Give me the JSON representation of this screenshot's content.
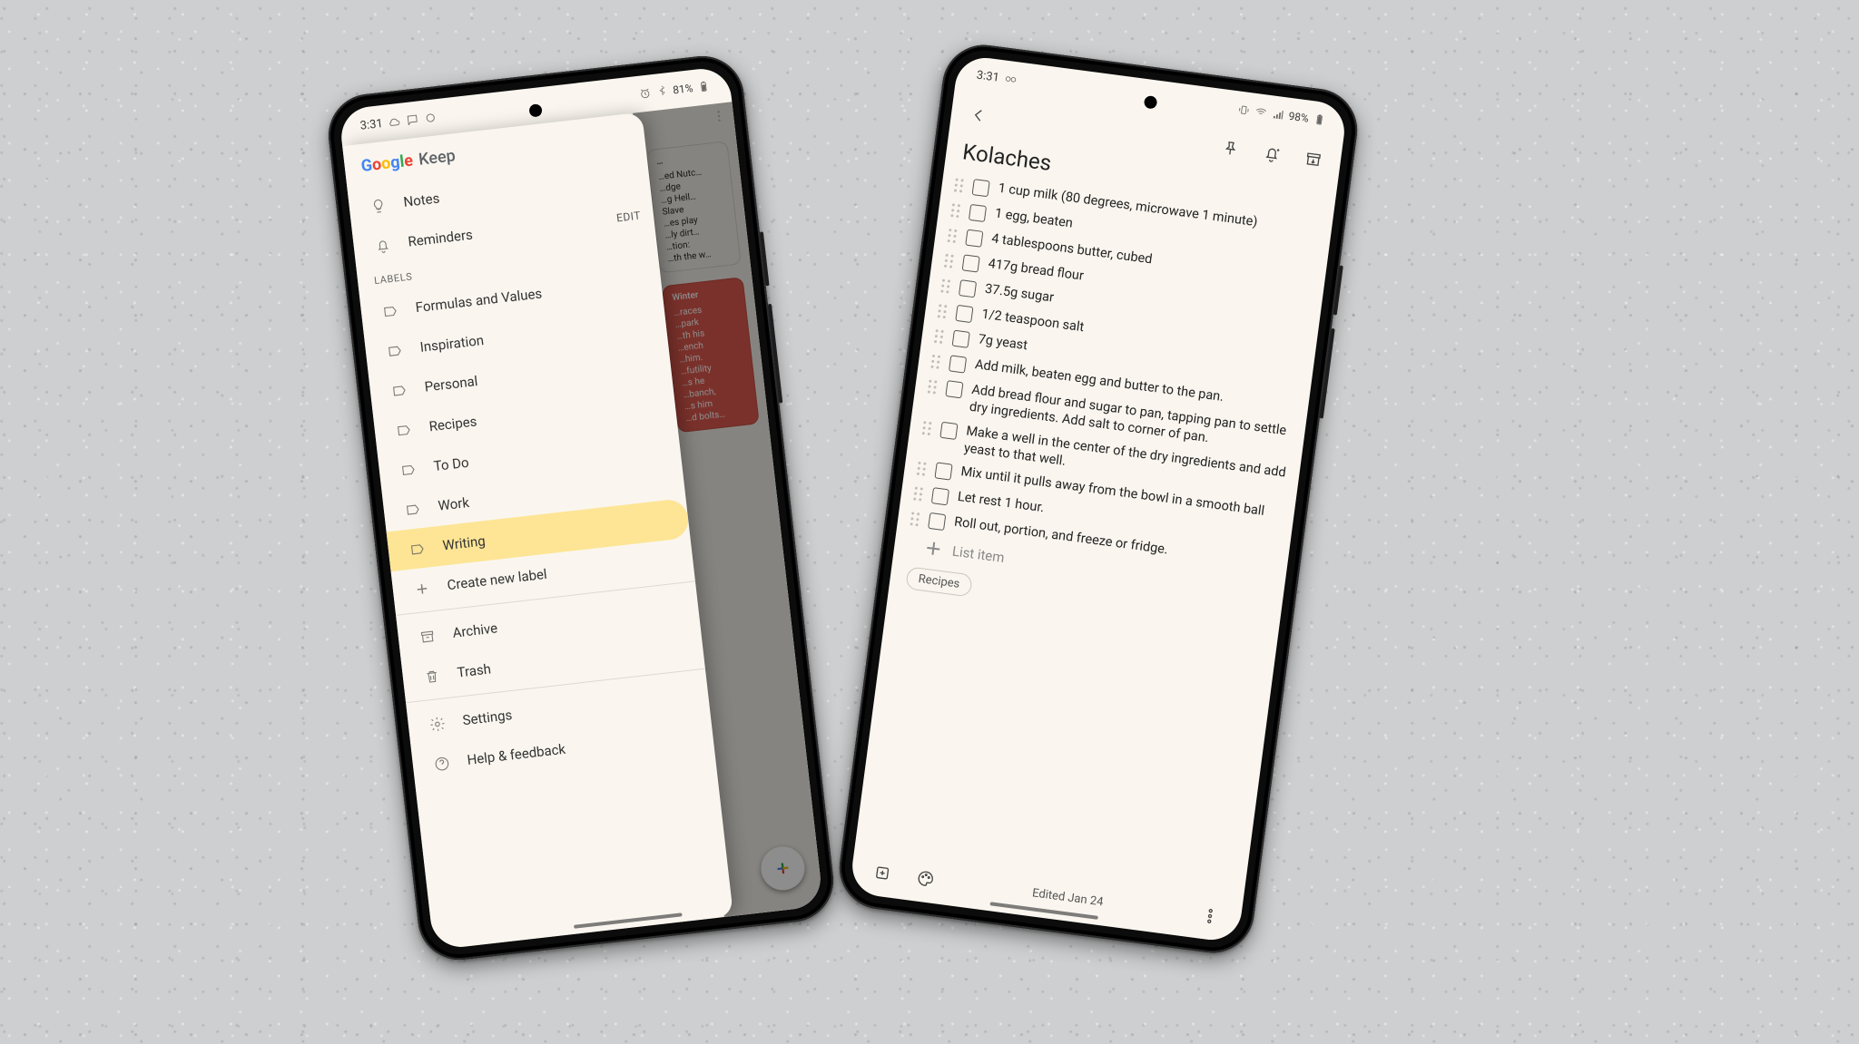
{
  "colors": {
    "drawer_highlight": "#fde595",
    "accent_red": "#e06055"
  },
  "phone1": {
    "status": {
      "time": "3:31",
      "battery": "81%"
    },
    "app_brand_google": "Google",
    "app_brand_keep": "Keep",
    "drawer": {
      "primary": {
        "notes": "Notes",
        "reminders": "Reminders",
        "edit": "EDIT"
      },
      "labels_header": "LABELS",
      "labels": [
        "Formulas and Values",
        "Inspiration",
        "Personal",
        "Recipes",
        "To Do",
        "Work",
        "Writing"
      ],
      "create_label": "Create new label",
      "archive": "Archive",
      "trash": "Trash",
      "settings": "Settings",
      "help": "Help & feedback"
    },
    "behind_notes": [
      {
        "title": "…",
        "lines": [
          "…ed Nutc…",
          "…dge",
          "…g Hell…",
          "Slave",
          "…es play",
          "…ly dirt…",
          "…tion:",
          "…th the w…"
        ]
      },
      {
        "title": "Winter",
        "lines": [
          "…races",
          "…park",
          "…th his",
          "…ench",
          "…him.",
          "…futility",
          "…s he",
          "…banch,",
          "…s him",
          "…d bolts…"
        ],
        "color": "red"
      }
    ]
  },
  "phone2": {
    "status": {
      "time": "3:31",
      "battery": "98%"
    },
    "title": "Kolaches",
    "items": [
      "1 cup milk (80 degrees, microwave 1 minute)",
      "1 egg, beaten",
      "4 tablespoons butter, cubed",
      "417g bread flour",
      "37.5g sugar",
      "1/2 teaspoon salt",
      "7g yeast",
      "Add milk, beaten egg and butter to the pan.",
      "Add bread flour and sugar to pan, tapping pan to settle dry ingredients. Add salt to corner of pan.",
      "Make a well in the center of the dry ingredients and add yeast to that well.",
      "Mix until it pulls away from the bowl in a smooth ball",
      "Let rest 1 hour.",
      "Roll out, portion, and freeze or fridge."
    ],
    "add_item_placeholder": "List item",
    "chip": "Recipes",
    "edited": "Edited Jan 24"
  }
}
